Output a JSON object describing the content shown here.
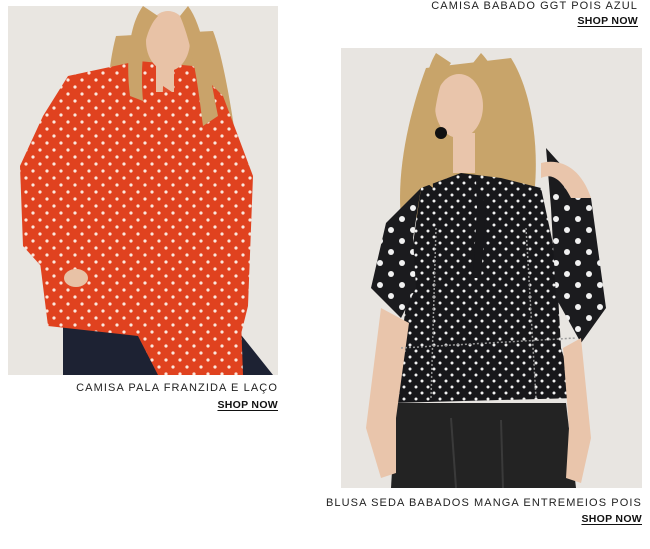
{
  "products": [
    {
      "name": "CAMISA BABADO GGT POIS AZUL",
      "cta": "SHOP NOW"
    },
    {
      "name": "CAMISA PALA FRANZIDA E LAÇO",
      "cta": "SHOP NOW",
      "image": {
        "description": "model wearing red-orange polka dot blouse and dark jeans",
        "colors": {
          "background": "#e9e6e1",
          "garment": "#e0421f",
          "dots": "#fbe7dc",
          "jeans": "#1d2233",
          "hair": "#c9a36a",
          "skin": "#e8c2a6"
        }
      }
    },
    {
      "name": "BLUSA SEDA BABADOS MANGA ENTREMEIOS POIS",
      "cta": "SHOP NOW",
      "image": {
        "description": "model wearing black polka dot ruffled cold-shoulder blouse and leather skirt",
        "colors": {
          "background": "#e8e5e1",
          "garment": "#17171a",
          "dots": "#f1f1f1",
          "skirt": "#232323",
          "hair": "#c8a46a",
          "skin": "#e9c5ab"
        }
      }
    }
  ]
}
